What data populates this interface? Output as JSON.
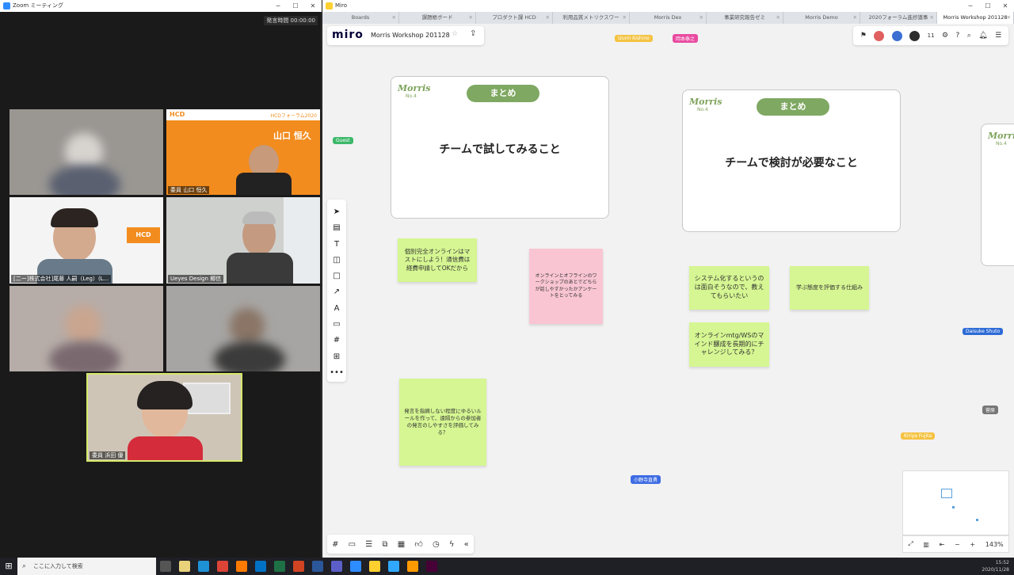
{
  "zoom": {
    "window_title": "Zoom ミーティング",
    "timer": "発言時間 00:00:00",
    "participants": [
      {
        "label": ""
      },
      {
        "label": "委員 山口 恒久",
        "banner_name": "山口 恒久",
        "banner_title": "HCDフォーラム2020",
        "banner_logo": "HCD"
      },
      {
        "label": "[二ー]株式会社]尾藤 人嗣（Leg）(L...",
        "logo": "HCD"
      },
      {
        "label": "Ueyes Design 郷信"
      },
      {
        "label": ""
      },
      {
        "label": ""
      },
      {
        "label": "委員 浜田 優"
      }
    ]
  },
  "miro": {
    "window_title": "Miro",
    "tabs": [
      {
        "label": "Boards"
      },
      {
        "label": "課題帳ボード"
      },
      {
        "label": "プロダクト課 HCD"
      },
      {
        "label": "利用品質メトリクスワー"
      },
      {
        "label": "Morris Dex"
      },
      {
        "label": "事業研究報告ゼミ"
      },
      {
        "label": "Morris Demo"
      },
      {
        "label": "2020フォーラム進捗議事"
      },
      {
        "label": "Morris Workshop 201128"
      }
    ],
    "logo": "miro",
    "board_name": "Morris Workshop 201128",
    "participant_count": "11",
    "zoom_level": "143%",
    "cursors": [
      {
        "name": "Izumi Kishino",
        "color": "#f5c342"
      },
      {
        "name": "岡本泰之",
        "color": "#e94aa0"
      },
      {
        "name": "Guest",
        "color": "#3db86a"
      },
      {
        "name": "Daisuke Shuto",
        "color": "#2d6bd6"
      },
      {
        "name": "菅原",
        "color": "#777777"
      },
      {
        "name": "Kiriya Fujita",
        "color": "#f5c342"
      },
      {
        "name": "小野寺直勇",
        "color": "#3d6be3"
      }
    ],
    "frames": [
      {
        "brand": "Morris",
        "no": "No.4",
        "pill": "まとめ",
        "heading": "チームで試してみること"
      },
      {
        "brand": "Morris",
        "no": "No.4",
        "pill": "まとめ",
        "heading": "チームで検討が必要なこと"
      },
      {
        "brand": "Morris",
        "no": "No.4"
      }
    ],
    "stickies": [
      {
        "text": "個別完全オンラインはマストにしよう！通信費は経費申請してOKだから"
      },
      {
        "text": "オンラインとオフラインのワークショップのあとでどちらが話しやすかったかアンケートをとってみる"
      },
      {
        "text": "発言を指摘しない程度にゆるいルールを作って、遠隔からの参加者の発言のしやすさを評価してみる？"
      },
      {
        "text": "システム化するというのは面白そうなので、教えてもらいたい"
      },
      {
        "text": "学ぶ態度を評価する仕組み"
      },
      {
        "text": "オンラインmtg/WSのマインド醸成を長期的にチャレンジしてみる？"
      }
    ]
  },
  "taskbar": {
    "search_placeholder": "ここに入力して検索",
    "time": "15:52",
    "date": "2020/11/28"
  }
}
